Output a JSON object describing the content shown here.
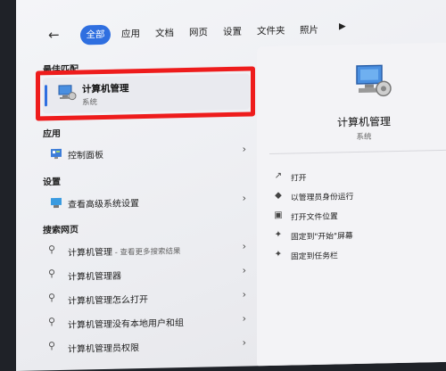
{
  "tabs": [
    "全部",
    "应用",
    "文档",
    "网页",
    "设置",
    "文件夹",
    "照片"
  ],
  "best_match": {
    "section": "最佳匹配",
    "name": "计算机管理",
    "type": "系统"
  },
  "apps": {
    "section": "应用",
    "items": [
      {
        "label": "控制面板"
      }
    ]
  },
  "settings": {
    "section": "设置",
    "items": [
      {
        "label": "查看高级系统设置"
      }
    ]
  },
  "web": {
    "section": "搜索网页",
    "items": [
      {
        "label": "计算机管理",
        "hint": " - 查看更多搜索结果"
      },
      {
        "label": "计算机管理器",
        "hint": ""
      },
      {
        "label": "计算机管理怎么打开",
        "hint": ""
      },
      {
        "label": "计算机管理没有本地用户和组",
        "hint": ""
      },
      {
        "label": "计算机管理员权限",
        "hint": ""
      }
    ]
  },
  "detail": {
    "title": "计算机管理",
    "type": "系统",
    "actions": [
      {
        "label": "打开",
        "icon": "open-icon"
      },
      {
        "label": "以管理员身份运行",
        "icon": "shield-icon"
      },
      {
        "label": "打开文件位置",
        "icon": "folder-icon"
      },
      {
        "label": "固定到\"开始\"屏幕",
        "icon": "pin-icon"
      },
      {
        "label": "固定到任务栏",
        "icon": "pin-icon"
      }
    ]
  },
  "colors": {
    "accent": "#2f6fe0",
    "highlight_box": "#ee1c1c"
  }
}
